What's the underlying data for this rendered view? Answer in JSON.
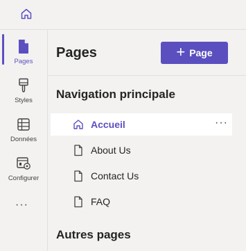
{
  "rail": {
    "items": [
      {
        "label": "Pages",
        "icon": "page-icon",
        "active": true
      },
      {
        "label": "Styles",
        "icon": "paintbrush-icon"
      },
      {
        "label": "Données",
        "icon": "table-icon"
      },
      {
        "label": "Configurer",
        "icon": "settings-window-icon"
      }
    ],
    "more": "···"
  },
  "panel": {
    "title": "Pages",
    "add_button": {
      "icon": "+",
      "label": "Page"
    },
    "sections": [
      {
        "title": "Navigation principale",
        "items": [
          {
            "label": "Accueil",
            "icon": "home-icon",
            "selected": true,
            "more": "···"
          },
          {
            "label": "About Us",
            "icon": "document-icon"
          },
          {
            "label": "Contact Us",
            "icon": "document-icon"
          },
          {
            "label": "FAQ",
            "icon": "document-icon"
          }
        ]
      },
      {
        "title": "Autres pages"
      }
    ]
  },
  "colors": {
    "accent": "#5b4fbf",
    "background": "#f3f2f1",
    "selected_row": "#ffffff"
  }
}
